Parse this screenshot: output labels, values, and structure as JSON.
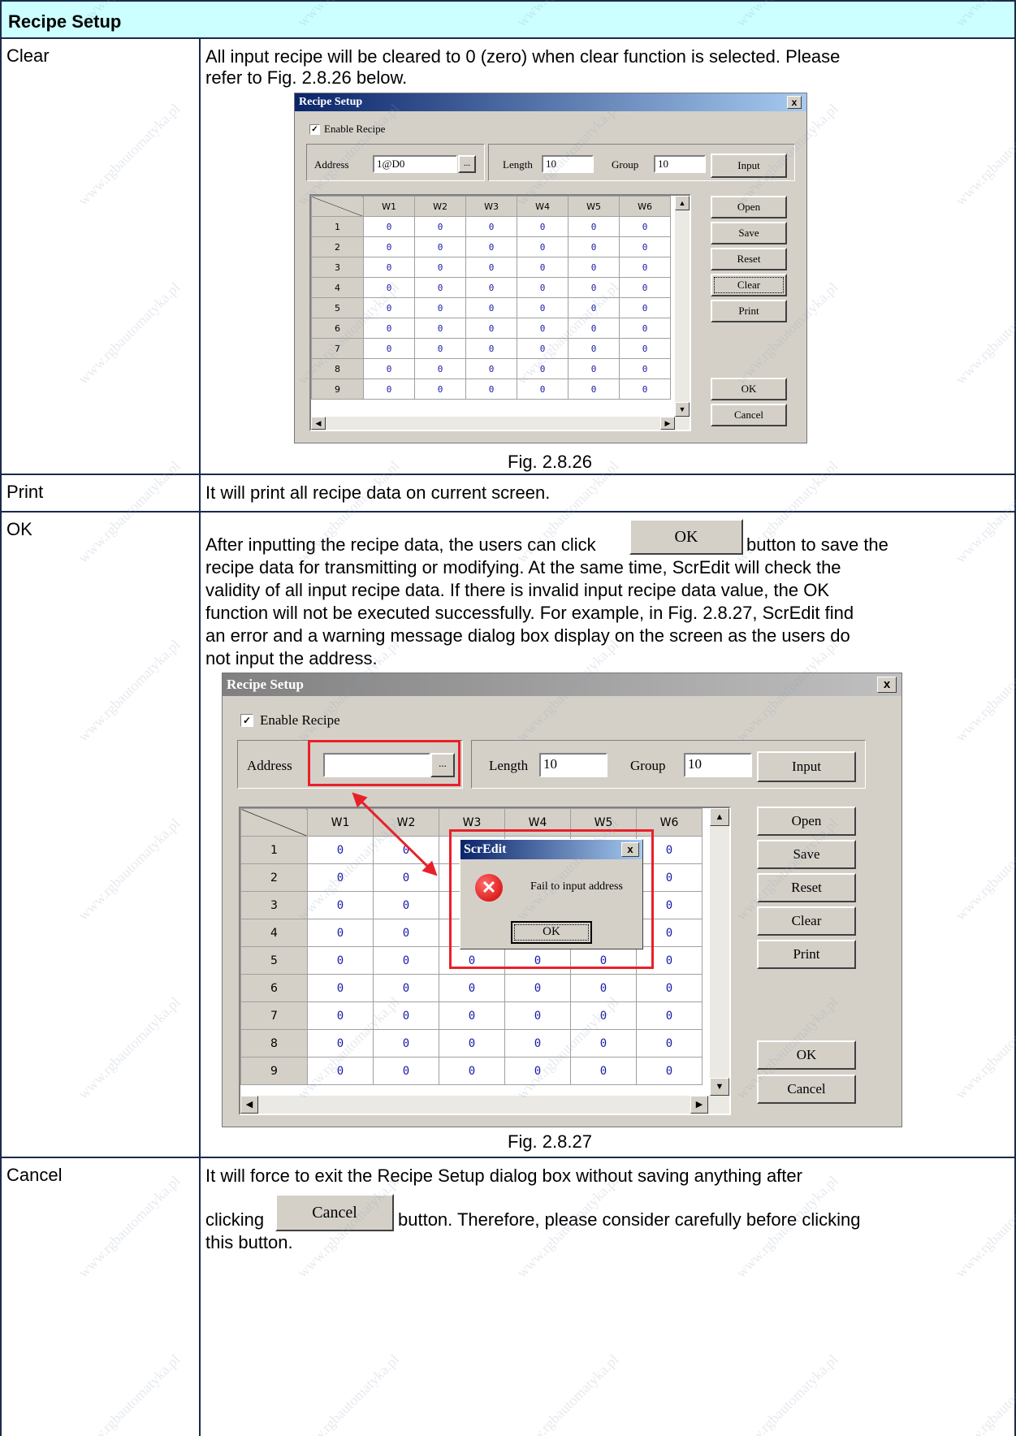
{
  "section_title": "Recipe Setup",
  "rows": {
    "clear": {
      "label": "Clear",
      "text1": "All input recipe will be cleared to 0 (zero) when clear function is selected. Please",
      "text2": "refer to Fig. 2.8.26 below.",
      "caption": "Fig. 2.8.26"
    },
    "print": {
      "label": "Print",
      "text": "It will print all recipe data on current screen."
    },
    "ok": {
      "label": "OK",
      "text_before_btn": "After inputting the recipe data, the users can click",
      "inline_btn": "OK",
      "text_after_btn": "button to save the",
      "lines": [
        "recipe data for transmitting or modifying. At the same time, ScrEdit will check the",
        "validity of all input recipe data. If there is invalid input recipe data value, the OK",
        "function will not be executed successfully. For example, in Fig. 2.8.27, ScrEdit find",
        "an error and a warning message dialog box display on the screen as the users do",
        "not input the address."
      ],
      "caption": "Fig. 2.8.27"
    },
    "cancel": {
      "label": "Cancel",
      "line1": "It will force to exit the Recipe Setup dialog box without saving anything after",
      "text_before_btn": "clicking",
      "inline_btn": "Cancel",
      "text_after_btn": "button. Therefore, please consider carefully before clicking",
      "line3": "this button."
    }
  },
  "dialog1": {
    "title": "Recipe Setup",
    "close": "x",
    "enable_label": "Enable Recipe",
    "enable_checked": true,
    "address_label": "Address",
    "address_value": "1@D0",
    "browse": "...",
    "length_label": "Length",
    "length_value": "10",
    "group_label": "Group",
    "group_value": "10",
    "input_btn": "Input",
    "columns": [
      "W1",
      "W2",
      "W3",
      "W4",
      "W5",
      "W6"
    ],
    "rows": [
      "1",
      "2",
      "3",
      "4",
      "5",
      "6",
      "7",
      "8",
      "9"
    ],
    "cell_value": "0",
    "buttons": [
      "Open",
      "Save",
      "Reset",
      "Clear",
      "Print"
    ],
    "ok_btn": "OK",
    "cancel_btn": "Cancel"
  },
  "dialog2": {
    "title": "Recipe Setup",
    "close": "x",
    "enable_label": "Enable Recipe",
    "enable_checked": true,
    "address_label": "Address",
    "address_value": "",
    "browse": "...",
    "length_label": "Length",
    "length_value": "10",
    "group_label": "Group",
    "group_value": "10",
    "input_btn": "Input",
    "columns": [
      "W1",
      "W2",
      "W3",
      "W4",
      "W5",
      "W6"
    ],
    "rows": [
      "1",
      "2",
      "3",
      "4",
      "5",
      "6",
      "7",
      "8",
      "9"
    ],
    "cell_value": "0",
    "buttons": [
      "Open",
      "Save",
      "Reset",
      "Clear",
      "Print"
    ],
    "ok_btn": "OK",
    "cancel_btn": "Cancel",
    "error": {
      "title": "ScrEdit",
      "close": "x",
      "message": "Fail to input address",
      "ok": "OK"
    }
  },
  "watermark": "www.rgbautomatyka.pl",
  "colors": {
    "header_bg": "#ccffff",
    "border": "#1b2a4a",
    "highlight": "#e8202a",
    "dialog_bg": "#d4d0c8"
  }
}
